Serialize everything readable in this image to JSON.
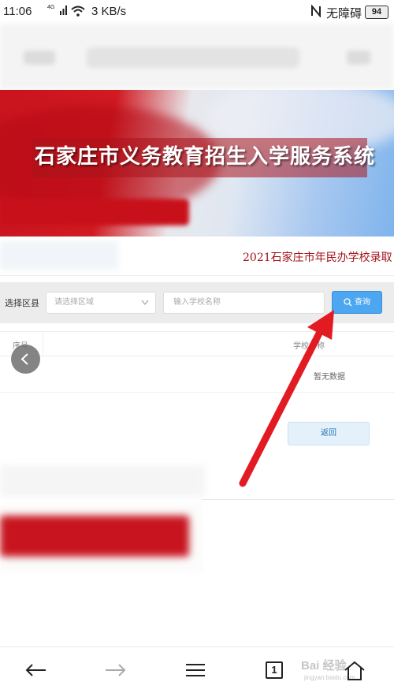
{
  "status_bar": {
    "time": "11:06",
    "network_type": "4G",
    "speed": "3 KB/s",
    "accessibility": "无障碍",
    "battery": "94"
  },
  "banner": {
    "title": "石家庄市义务教育招生入学服务系统",
    "subtitle": "2021石家庄市年民办学校录取"
  },
  "search": {
    "district_label": "选择区县",
    "district_placeholder": "请选择区域",
    "school_placeholder": "输入学校名称",
    "query_button": "查询"
  },
  "table": {
    "columns": [
      "序号",
      "学校名称"
    ],
    "empty_text": "暂无数据"
  },
  "return_button": "返回",
  "bottom_nav": {
    "tab_count": "1",
    "watermark": "Bai 经验",
    "watermark_sub": "jingyan.baidu.com"
  },
  "colors": {
    "banner_red": "#c9141d",
    "query_blue": "#4da6f0",
    "annotation_red": "#e21b23"
  }
}
